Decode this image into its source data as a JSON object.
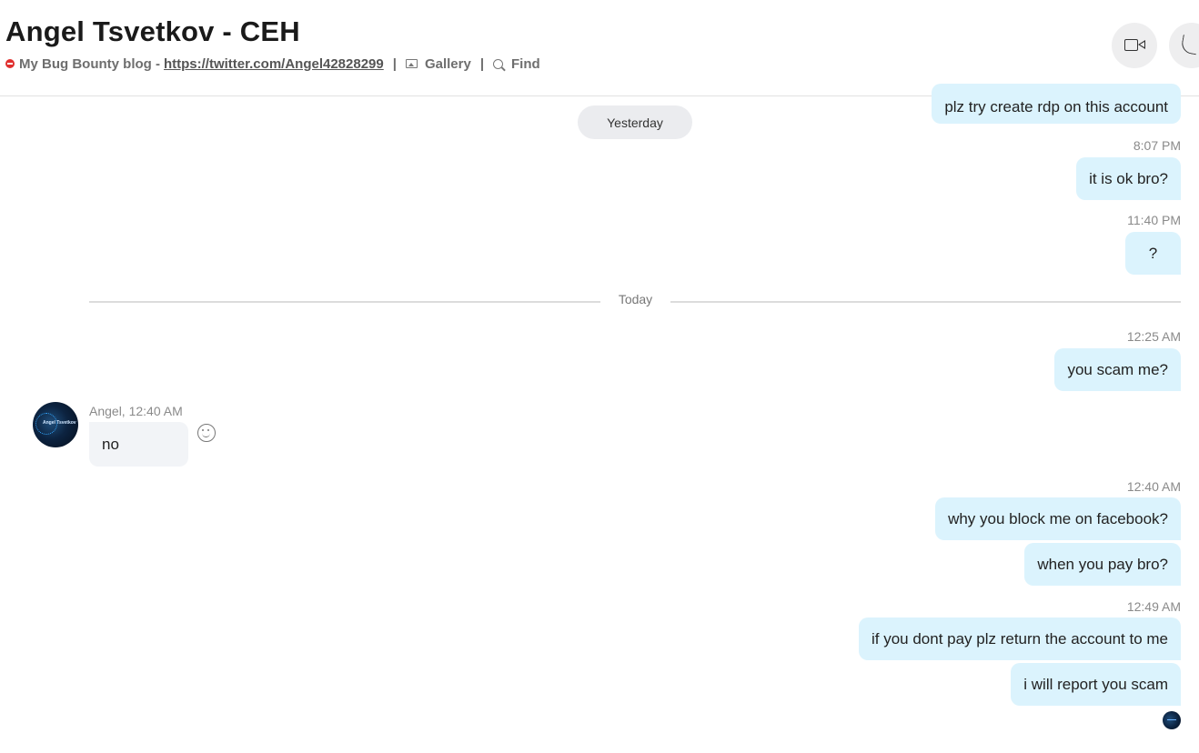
{
  "header": {
    "title": "Angel Tsvetkov - CEH",
    "mood_prefix": "My Bug Bounty blog -",
    "mood_link": "https://twitter.com/Angel42828299",
    "separator": "|",
    "gallery_label": "Gallery",
    "find_label": "Find",
    "status_color": "#e0302f"
  },
  "conversation": {
    "top_partial_message": "plz try create rdp on this account",
    "yesterday_pill": "Yesterday",
    "group1": {
      "time": "8:07 PM",
      "message": "it is ok bro?"
    },
    "group2": {
      "time": "11:40 PM",
      "message": "?"
    },
    "today_divider": "Today",
    "group3": {
      "time": "12:25 AM",
      "message": "you scam me?"
    },
    "incoming": {
      "sender_meta": "Angel, 12:40 AM",
      "message": "no",
      "avatar_text": "Angel Tsvetkov"
    },
    "group4": {
      "time": "12:40 AM",
      "messages": [
        "why you block me on facebook?",
        "when you pay bro?"
      ]
    },
    "group5": {
      "time": "12:49 AM",
      "messages": [
        "if you dont pay plz return the account to me",
        "i will report you scam"
      ]
    }
  },
  "colors": {
    "outgoing_bubble": "#dbf3fd",
    "incoming_bubble": "#f2f4f7",
    "pill_bg": "#ebecef"
  }
}
